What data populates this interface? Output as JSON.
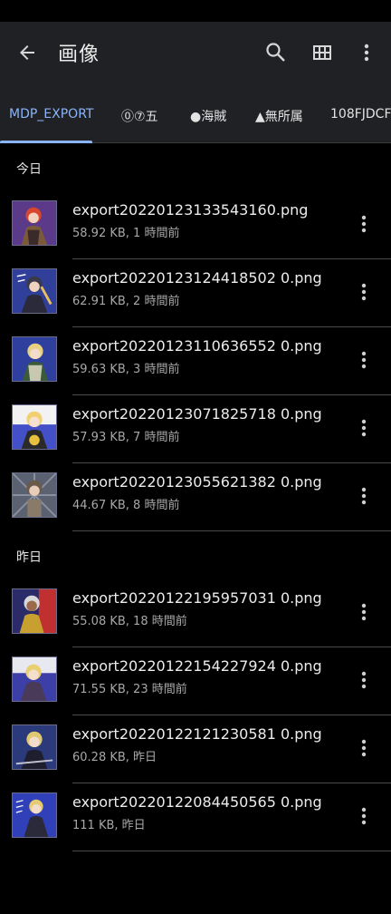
{
  "appbar": {
    "title": "画像",
    "back_icon": "arrow-left-icon",
    "search_icon": "search-icon",
    "grid_icon": "grid-view-icon",
    "more_icon": "more-vert-icon"
  },
  "tabs": [
    {
      "label": "MDP_EXPORT",
      "active": true
    },
    {
      "label": "⓪⑦五",
      "active": false
    },
    {
      "label": "●海賊",
      "active": false
    },
    {
      "label": "▲無所属",
      "active": false
    },
    {
      "label": "108FJDCF",
      "active": false
    }
  ],
  "sections": [
    {
      "title": "今日",
      "files": [
        {
          "name": "export20220123133543160.png",
          "meta": "58.92 KB, 1 時間前",
          "bg": "#5b3a8a"
        },
        {
          "name": "export20220123124418502 0.png",
          "meta": "62.91 KB, 2 時間前",
          "bg": "#2f3f9a"
        },
        {
          "name": "export20220123110636552 0.png",
          "meta": "59.63 KB, 3 時間前",
          "bg": "#2e3f9e"
        },
        {
          "name": "export20220123071825718 0.png",
          "meta": "57.93 KB, 7 時間前",
          "bg": "#4450c8"
        },
        {
          "name": "export20220123055621382 0.png",
          "meta": "44.67 KB, 8 時間前",
          "bg": "#5a6170"
        }
      ]
    },
    {
      "title": "昨日",
      "files": [
        {
          "name": "export20220122195957031 0.png",
          "meta": "55.08 KB, 18 時間前",
          "bg": "#2b2b6a"
        },
        {
          "name": "export20220122154227924 0.png",
          "meta": "71.55 KB, 23 時間前",
          "bg": "#3c3fa8"
        },
        {
          "name": "export20220122121230581 0.png",
          "meta": "60.28 KB, 昨日",
          "bg": "#2a3a7a"
        },
        {
          "name": "export20220122084450565 0.png",
          "meta": "111 KB, 昨日",
          "bg": "#2f40b8"
        }
      ]
    }
  ]
}
